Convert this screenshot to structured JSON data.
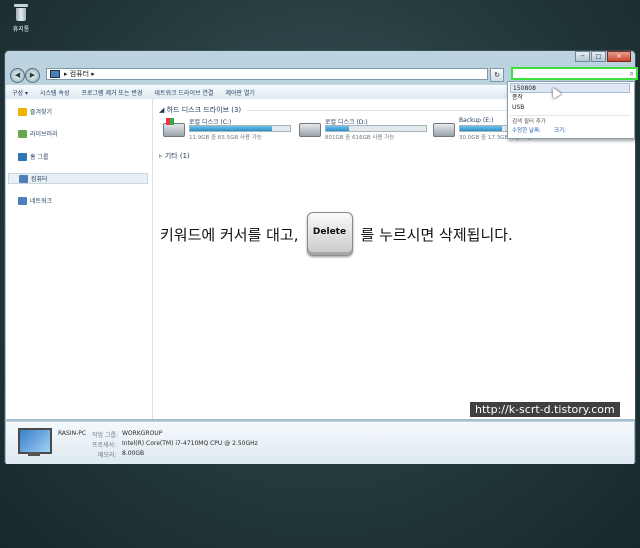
{
  "desktop": {
    "recycle_bin_label": "휴지통"
  },
  "window": {
    "controls": {
      "minimize": "─",
      "maximize": "□",
      "close": "✕"
    },
    "nav": {
      "back": "◀",
      "forward": "▶",
      "address_text": "▸ 컴퓨터 ▸",
      "refresh": "↻"
    },
    "search": {
      "value": "",
      "icon": "⌕"
    }
  },
  "toolbar": {
    "items": [
      "구성 ▾",
      "시스템 속성",
      "프로그램 제거 또는 변경",
      "네트워크 드라이브 연결",
      "제어판 열기"
    ]
  },
  "sidebar": {
    "items": [
      {
        "label": "즐겨찾기",
        "color": "#f0b400"
      },
      {
        "label": "라이브러리",
        "color": "#6aa84f"
      },
      {
        "label": "홈 그룹",
        "color": "#2f74b5"
      },
      {
        "label": "컴퓨터",
        "color": "#4c7fb8"
      },
      {
        "label": "네트워크",
        "color": "#4c7fb8"
      }
    ]
  },
  "content": {
    "hdd_group": "◢ 하드 디스크 드라이브 (3)",
    "other_group": "▹ 기타 (1)",
    "drives": [
      {
        "name": "로컬 디스크 (C:)",
        "free": "11.9GB 중 65.5GB 사용 가능",
        "used_fraction": 0.82
      },
      {
        "name": "로컬 디스크 (D:)",
        "free": "801GB 중 616GB 사용 가능",
        "used_fraction": 0.23
      },
      {
        "name": "Backup (E:)",
        "free": "30.0GB 중 17.3GB 사용 가능",
        "used_fraction": 0.42
      }
    ]
  },
  "overlay": {
    "before": "키워드에 커서를 대고,",
    "key": "Delete",
    "after": "를 누르시면 삭제됩니다."
  },
  "watermark": "http://k-scrt-d.tistory.com",
  "details": {
    "pc_name": "RASIN-PC",
    "workgroup_label": "작업 그룹:",
    "workgroup": "WORKGROUP",
    "cpu_label": "프로세서:",
    "cpu": "Intel(R) Core(TM) i7-4710MQ CPU @ 2.50GHz",
    "mem_label": "메모리:",
    "mem": "8.00GB"
  },
  "search_dropdown": {
    "items": [
      "150808",
      "종작",
      "USB"
    ],
    "filter_label": "검색 필터 추가",
    "filters": [
      "수정한 날짜:",
      "크기:"
    ]
  }
}
